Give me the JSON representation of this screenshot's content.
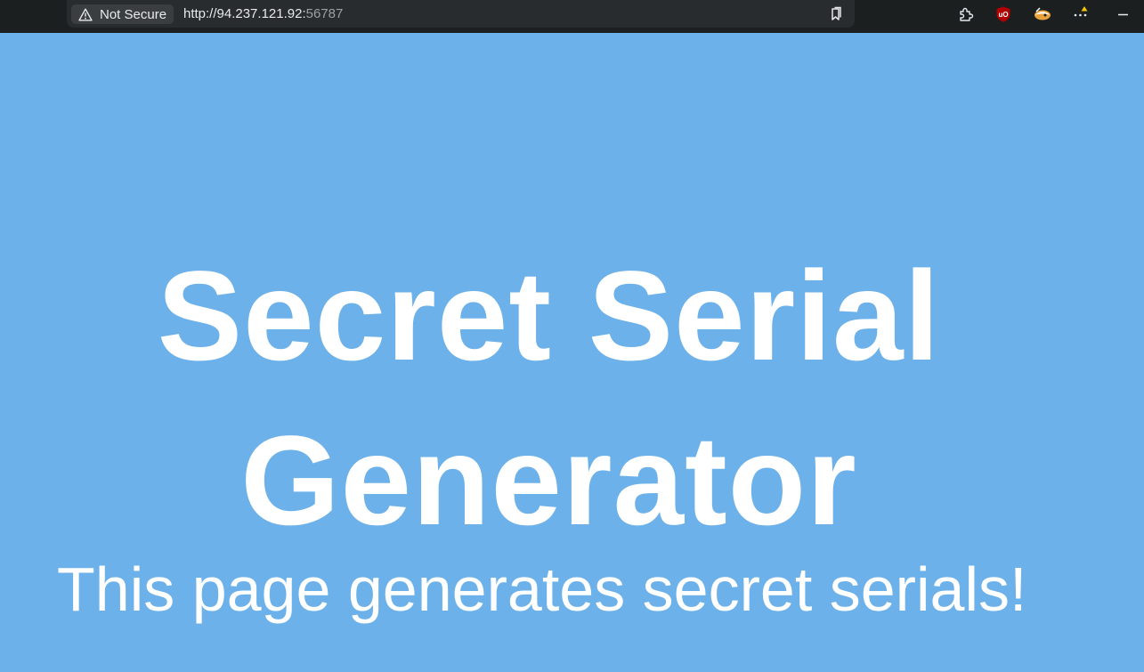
{
  "browser": {
    "security_label": "Not Secure",
    "url_host": "http://94.237.121.92:",
    "url_port": "56787",
    "icons": [
      "warning-triangle-icon",
      "bookmark-icon",
      "extensions-puzzle-icon",
      "ublock-origin-icon",
      "extension-badger-icon",
      "more-menu-icon",
      "minimize-icon"
    ],
    "colors": {
      "toolbar": "#1b1f20",
      "address_bar": "#282c2e",
      "ublock_red": "#b00000",
      "notification_dot": "#f5c400"
    }
  },
  "page": {
    "title": "Secret Serial Generator",
    "subtitle": "This page generates secret serials!",
    "colors": {
      "background": "#6cb1e9",
      "text": "#ffffff"
    }
  }
}
